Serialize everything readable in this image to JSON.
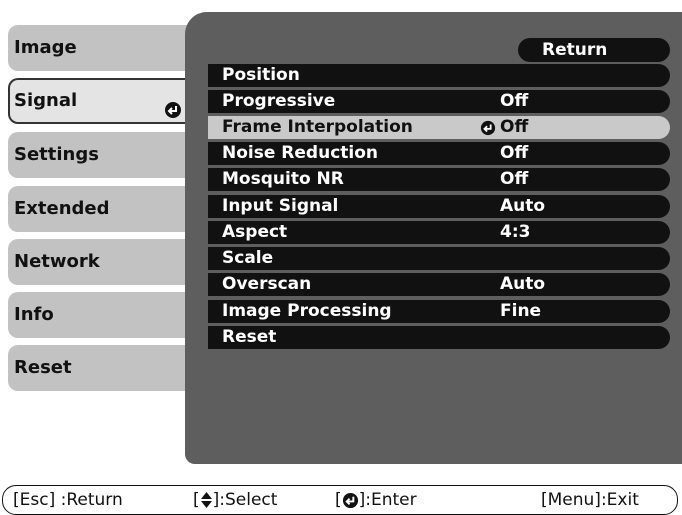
{
  "sidebar": {
    "items": [
      {
        "label": "Image"
      },
      {
        "label": "Signal"
      },
      {
        "label": "Settings"
      },
      {
        "label": "Extended"
      },
      {
        "label": "Network"
      },
      {
        "label": "Info"
      },
      {
        "label": "Reset"
      }
    ]
  },
  "panel": {
    "return_label": "Return",
    "rows": [
      {
        "label": "Position",
        "value": ""
      },
      {
        "label": "Progressive",
        "value": "Off"
      },
      {
        "label": "Frame Interpolation",
        "value": "Off"
      },
      {
        "label": "Noise Reduction",
        "value": "Off"
      },
      {
        "label": "Mosquito NR",
        "value": "Off"
      },
      {
        "label": "Input Signal",
        "value": "Auto"
      },
      {
        "label": "Aspect",
        "value": "4:3"
      },
      {
        "label": "Scale",
        "value": ""
      },
      {
        "label": "Overscan",
        "value": "Auto"
      },
      {
        "label": "Image Processing",
        "value": "Fine"
      },
      {
        "label": "Reset",
        "value": ""
      }
    ]
  },
  "footer": {
    "esc": "[Esc] :Return",
    "select_open": "[",
    "select_close": "]:Select",
    "enter_open": "[",
    "enter_close": "]:Enter",
    "menu": "[Menu]:Exit"
  },
  "icons": {
    "enter": "enter-icon",
    "updown": "up-down-arrow-icon"
  },
  "colors": {
    "panel_bg": "#5e5e5e",
    "row_bg": "#111111",
    "selected_row": "#c9c9c9",
    "sidebar_tab": "#c2c2c2"
  }
}
